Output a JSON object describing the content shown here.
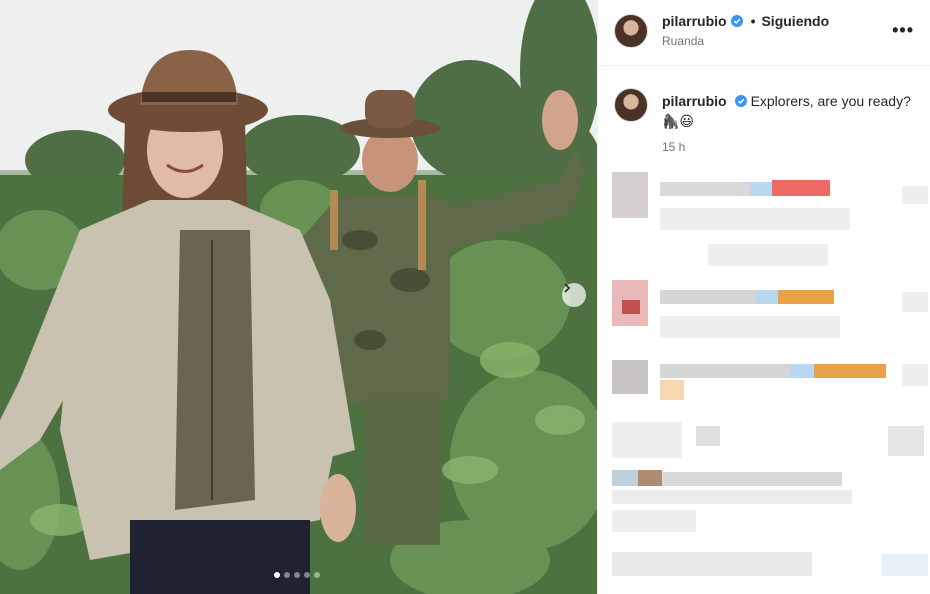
{
  "header": {
    "username": "pilarrubio",
    "separator": "•",
    "follow_label": "Siguiendo",
    "location": "Ruanda",
    "more_label": "•••"
  },
  "caption": {
    "username": "pilarrubio",
    "text": "Explorers, are you ready?",
    "emojis": "🦍😃",
    "time": "15 h"
  },
  "carousel": {
    "slide_count": 5,
    "active_index": 0
  },
  "colors": {
    "verified_blue": "#3897f0",
    "text_primary": "#262626",
    "text_secondary": "#737373"
  }
}
